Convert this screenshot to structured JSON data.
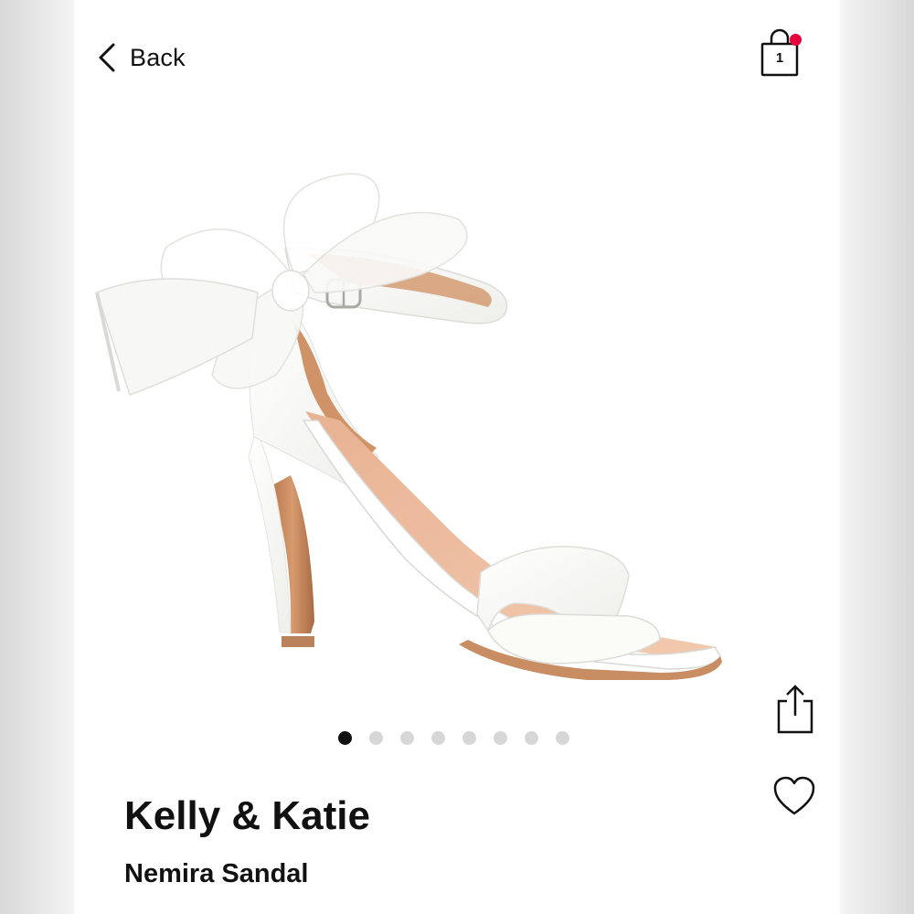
{
  "header": {
    "back_label": "Back",
    "cart_count": "1",
    "cart_badge_color": "#e4003b",
    "icons": {
      "back": "chevron-left-icon",
      "cart": "shopping-bag-icon"
    }
  },
  "gallery": {
    "image_subject": "white satin ankle-strap heel sandal with tulle bow",
    "total_images": 8,
    "active_index": 0
  },
  "actions": {
    "icons": {
      "share": "share-icon",
      "favorite": "heart-icon"
    }
  },
  "product": {
    "brand": "Kelly & Katie",
    "name": "Nemira Sandal"
  }
}
